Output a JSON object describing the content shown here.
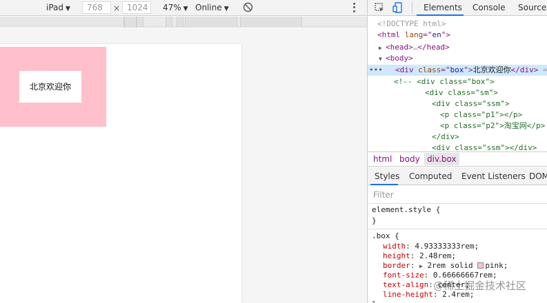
{
  "device_toolbar": {
    "device": "iPad",
    "width": "768",
    "times": "×",
    "height": "1024",
    "zoom": "47%",
    "network": "Online"
  },
  "page": {
    "box_text": "北京欢迎你",
    "box_color": "#ffc0cb"
  },
  "devtools": {
    "tabs": [
      "Elements",
      "Console",
      "Sources"
    ],
    "active_tab": "Elements",
    "dom": [
      {
        "text": "<!DOCTYPE html>"
      },
      {
        "tag_open": "<html",
        "attr": " lang",
        "eq": "=\"",
        "val": "en",
        "close": "\">"
      },
      {
        "tag": "<head>",
        "ellipsis": "…",
        "tag_end": "</head>"
      },
      {
        "tag": "<body>"
      },
      {
        "dots": "•••",
        "tag_open": "<div",
        "attr": " class",
        "eq": "=\"",
        "val": "box",
        "close": "\">",
        "content": "北京欢迎你",
        "tag_end": "</div>",
        "extra": " =="
      },
      {
        "comment": "<!-- <div class=\"box\">"
      },
      {
        "comment": "<div class=\"sm\">"
      },
      {
        "comment": "<div class=\"ssm\">"
      },
      {
        "comment": "<p class=\"p1\"></p>"
      },
      {
        "comment": "<p class=\"p2\">淘宝网</p>"
      },
      {
        "comment": "</div>"
      },
      {
        "comment": "<div class=\"ssm\"></div>"
      }
    ],
    "breadcrumbs": [
      "html",
      "body",
      "div.box"
    ],
    "styles_tabs": [
      "Styles",
      "Computed",
      "Event Listeners",
      "DOM"
    ],
    "filter_placeholder": "Filter",
    "element_style": {
      "selector": "element.style {",
      "close": "}"
    },
    "box_rule": {
      "selector": ".box {",
      "props": [
        {
          "name": "width",
          "value": "4.93333333rem;"
        },
        {
          "name": "height",
          "value": "2.48rem;"
        },
        {
          "name": "border",
          "value": "2rem solid",
          "swatch_label": "pink;"
        },
        {
          "name": "font-size",
          "value": "0.66666667rem;"
        },
        {
          "name": "text-align",
          "value": "center;"
        },
        {
          "name": "line-height",
          "value": "2.4rem;"
        }
      ],
      "close": "}"
    }
  },
  "watermark": "@稀土掘金技术社区"
}
